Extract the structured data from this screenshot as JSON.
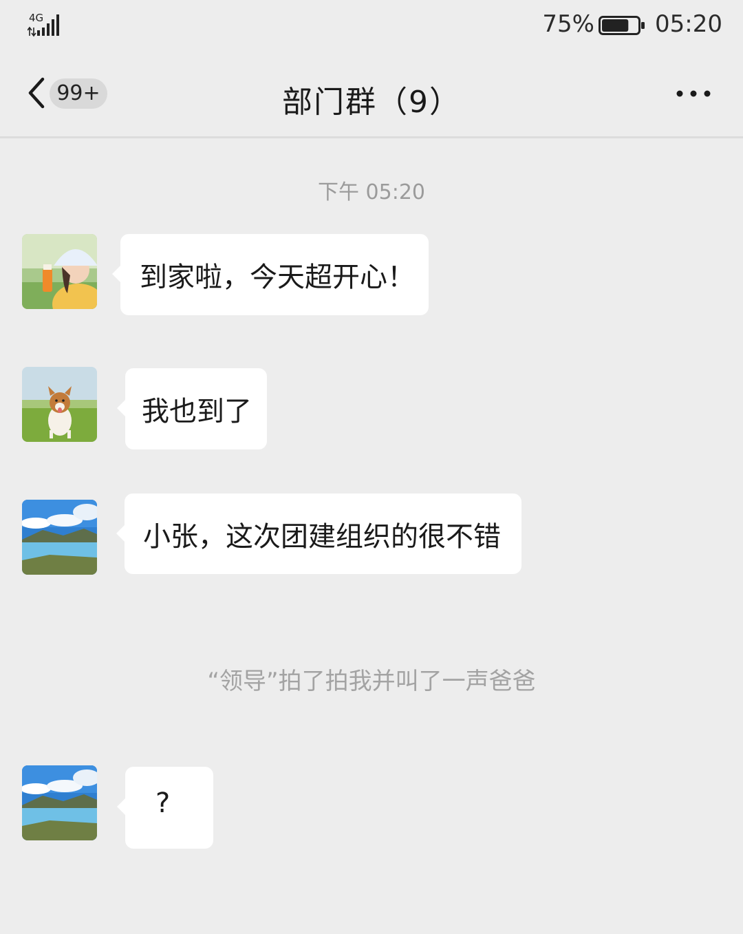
{
  "status_bar": {
    "network": "4G",
    "battery_percent": "75%",
    "battery_level": 0.75,
    "time": "05:20"
  },
  "nav": {
    "unread_count": "99+",
    "title": "部门群（9）"
  },
  "chat": {
    "timestamp": "下午 05:20",
    "messages": [
      {
        "avatar": "girl-photo-avatar",
        "text": "到家啦，今天超开心！"
      },
      {
        "avatar": "puppy-photo-avatar",
        "text": "我也到了"
      },
      {
        "avatar": "lake-landscape-avatar",
        "text": "小张，这次团建组织的很不错"
      },
      {
        "avatar": "lake-landscape-avatar",
        "text": "?"
      }
    ],
    "system_note": "“领导”拍了拍我并叫了一声爸爸"
  },
  "colors": {
    "background": "#ededed",
    "bubble": "#ffffff",
    "badge": "#d9d9d9",
    "muted_text": "#9b9b9b"
  }
}
